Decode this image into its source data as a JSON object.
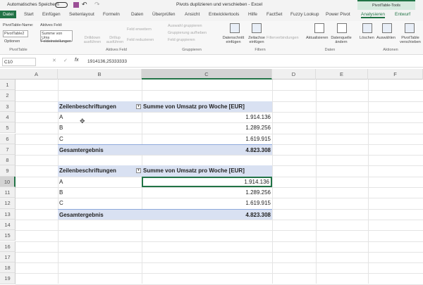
{
  "titlebar": {
    "autosave": "Automatisches Speichern",
    "title": "Pivots duplizieren und verschieben  -  Excel",
    "context": "PivotTable-Tools"
  },
  "tabs": [
    "Datei",
    "Start",
    "Einfügen",
    "Seitenlayout",
    "Formeln",
    "Daten",
    "Überprüfen",
    "Ansicht",
    "Entwicklertools",
    "Hilfe",
    "FactSet",
    "Fuzzy Lookup",
    "Power Pivot",
    "Analysieren",
    "Entwurf"
  ],
  "ribbon": {
    "pivottable": {
      "name_label": "PivotTable-Name:",
      "name_value": "PivotTable2",
      "options": "Optionen",
      "group": "PivotTable"
    },
    "active_field": {
      "label": "Aktives Feld:",
      "value": "Summe von Ums",
      "settings": "Feldeinstellungen",
      "drilldown": "Drilldown ausführen",
      "drillup": "Drillup ausführen",
      "expand": "Feld erweitern",
      "collapse": "Feld reduzieren",
      "group": "Aktives Feld"
    },
    "grouping": {
      "selection": "Auswahl gruppieren",
      "ungroup": "Gruppierung aufheben",
      "field": "Feld gruppieren",
      "group": "Gruppieren"
    },
    "filter": {
      "slicer": "Datenschnitt einfügen",
      "timeline": "Zeitachse einfügen",
      "connections": "Filterverbindungen",
      "group": "Filtern"
    },
    "data": {
      "refresh": "Aktualisieren",
      "source": "Datenquelle ändern",
      "group": "Daten"
    },
    "actions": {
      "clear": "Löschen",
      "select": "Auswählen",
      "move": "PivotTable verschieben",
      "group": "Aktionen"
    }
  },
  "formula_bar": {
    "name_box": "C10",
    "formula": "1914136,25333333"
  },
  "columns": [
    "A",
    "B",
    "C",
    "D",
    "E",
    "F"
  ],
  "rows": [
    "1",
    "2",
    "3",
    "4",
    "5",
    "6",
    "7",
    "8",
    "9",
    "10",
    "11",
    "12",
    "13",
    "14",
    "15",
    "16",
    "17",
    "18",
    "19"
  ],
  "pivots": [
    {
      "header": [
        "Zeilenbeschriftungen",
        "Summe von Umsatz pro Woche [EUR]"
      ],
      "items": [
        [
          "A",
          "1.914.136"
        ],
        [
          "B",
          "1.289.256"
        ],
        [
          "C",
          "1.619.915"
        ]
      ],
      "total": [
        "Gesamtergebnis",
        "4.823.308"
      ]
    },
    {
      "header": [
        "Zeilenbeschriftungen",
        "Summe von Umsatz pro Woche [EUR]"
      ],
      "items": [
        [
          "A",
          "1.914.136"
        ],
        [
          "B",
          "1.289.256"
        ],
        [
          "C",
          "1.619.915"
        ]
      ],
      "total": [
        "Gesamtergebnis",
        "4.823.308"
      ]
    }
  ],
  "colors": {
    "excel_green": "#217346",
    "pivot_header": "#d9e1f2"
  }
}
